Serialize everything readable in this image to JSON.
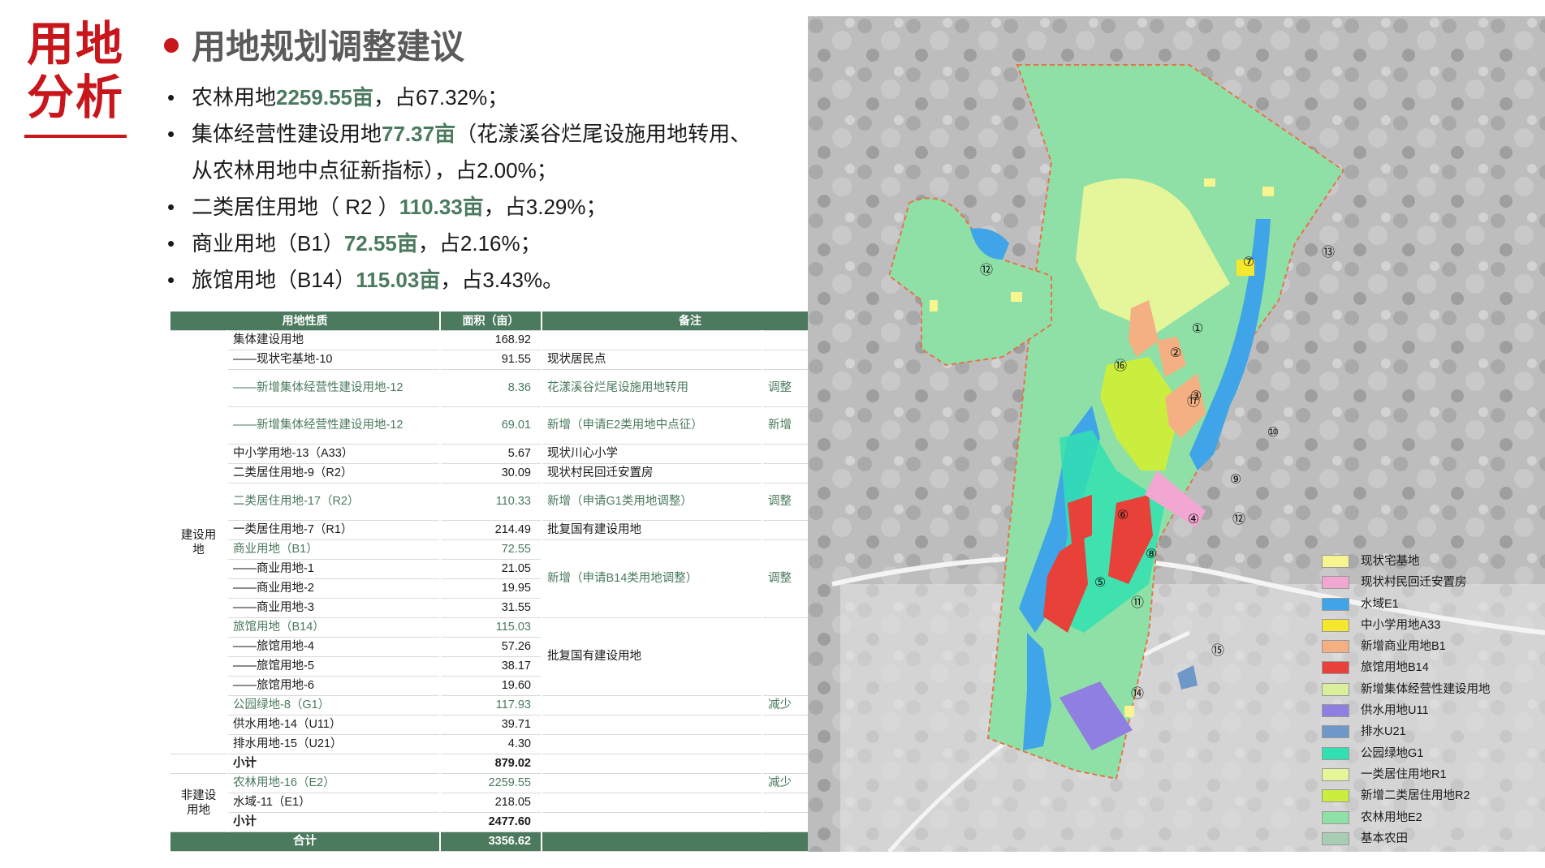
{
  "side_title_line1": "用地",
  "side_title_line2": "分析",
  "heading": "用地规划调整建议",
  "bullets": [
    {
      "pre": "农林用地",
      "hl": "2259.55亩",
      "post": "，占67.32%；"
    },
    {
      "pre": "集体经营性建设用地",
      "hl": "77.37亩",
      "post": "（花漾溪谷烂尾设施用地转用、",
      "cont": "从农林用地中点征新指标），占2.00%；"
    },
    {
      "pre": "二类居住用地（ R2 ）",
      "hl": "110.33亩",
      "post": "，占3.29%；"
    },
    {
      "pre": "商业用地（B1）",
      "hl": "72.55亩",
      "post": "，占2.16%；"
    },
    {
      "pre": "旅馆用地（B14）",
      "hl": "115.03亩",
      "post": "，占3.43%。"
    }
  ],
  "table": {
    "headers": [
      "用地性质",
      "面积（亩）",
      "备注"
    ],
    "group_build": "建设用\n地",
    "group_nonbuild": "非建设\n用地",
    "rows": [
      {
        "name": "集体建设用地",
        "area": "168.92",
        "note": "",
        "tag": ""
      },
      {
        "name": "——现状宅基地-10",
        "area": "91.55",
        "note": "现状居民点",
        "tag": ""
      },
      {
        "name": "——新增集体经营性建设用地-12",
        "area": "8.36",
        "note": "花漾溪谷烂尾设施用地转用",
        "tag": "调整"
      },
      {
        "name": "——新增集体经营性建设用地-12",
        "area": "69.01",
        "note": "新增（申请E2类用地中点征）",
        "tag": "新增"
      },
      {
        "name": "中小学用地-13（A33）",
        "area": "5.67",
        "note": "现状川心小学",
        "tag": ""
      },
      {
        "name": "二类居住用地-9（R2）",
        "area": "30.09",
        "note": "现状村民回迁安置房",
        "tag": ""
      },
      {
        "name": "二类居住用地-17（R2）",
        "area": "110.33",
        "note": "新增（申请G1类用地调整）",
        "tag": "调整"
      },
      {
        "name": "一类居住用地-7（R1）",
        "area": "214.49",
        "note": "批复国有建设用地",
        "tag": ""
      },
      {
        "name": "商业用地（B1）",
        "area": "72.55",
        "note": "新增（申请B14类用地调整）",
        "tag": "调整"
      },
      {
        "name": "——商业用地-1",
        "area": "21.05"
      },
      {
        "name": "——商业用地-2",
        "area": "19.95"
      },
      {
        "name": "——商业用地-3",
        "area": "31.55"
      },
      {
        "name": "旅馆用地（B14）",
        "area": "115.03",
        "note": "批复国有建设用地",
        "tag": ""
      },
      {
        "name": "——旅馆用地-4",
        "area": "57.26"
      },
      {
        "name": "——旅馆用地-5",
        "area": "38.17"
      },
      {
        "name": "——旅馆用地-6",
        "area": "19.60"
      },
      {
        "name": "公园绿地-8（G1）",
        "area": "117.93",
        "note": "",
        "tag": "减少"
      },
      {
        "name": "供水用地-14（U11）",
        "area": "39.71",
        "note": "",
        "tag": ""
      },
      {
        "name": "排水用地-15（U21）",
        "area": "4.30",
        "note": "",
        "tag": ""
      },
      {
        "name": "小计",
        "area": "879.02"
      },
      {
        "name": "农林用地-16（E2）",
        "area": "2259.55",
        "note": "",
        "tag": "减少"
      },
      {
        "name": "水域-11（E1）",
        "area": "218.05",
        "note": "",
        "tag": ""
      },
      {
        "name": "小计",
        "area": "2477.60"
      }
    ],
    "total_label": "合计",
    "total_value": "3356.62"
  },
  "map_labels": [
    "①",
    "②",
    "③",
    "④",
    "⑤",
    "⑥",
    "⑦",
    "⑧",
    "⑨",
    "⑩",
    "⑪",
    "⑫",
    "⑫",
    "⑬",
    "⑭",
    "⑮",
    "⑯",
    "⑰"
  ],
  "legend": [
    {
      "label": "现状宅基地",
      "color": "#f7f58f"
    },
    {
      "label": "现状村民回迁安置房",
      "color": "#f2a7d3"
    },
    {
      "label": "水域E1",
      "color": "#3fa4e8"
    },
    {
      "label": "中小学用地A33",
      "color": "#f5e62e"
    },
    {
      "label": "新增商业用地B1",
      "color": "#f4b082"
    },
    {
      "label": "旅馆用地B14",
      "color": "#e8413a"
    },
    {
      "label": "新增集体经营性建设用地",
      "color": "#d9ef9c"
    },
    {
      "label": "供水用地U11",
      "color": "#8f7fe0"
    },
    {
      "label": "排水U21",
      "color": "#6f97c8"
    },
    {
      "label": "公园绿地G1",
      "color": "#31e0b0"
    },
    {
      "label": "一类居住用地R1",
      "color": "#e4f59a"
    },
    {
      "label": "新增二类居住用地R2",
      "color": "#cbee3e"
    },
    {
      "label": "农林用地E2",
      "color": "#8fe0a6"
    },
    {
      "label": "基本农田",
      "color": "#a8ccb4"
    }
  ]
}
